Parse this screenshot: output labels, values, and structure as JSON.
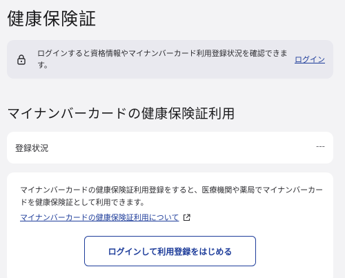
{
  "page": {
    "title": "健康保険証"
  },
  "login_banner": {
    "text": "ログインすると資格情報やマイナンバーカード利用登録状況を確認できます。",
    "link_label": "ログイン",
    "icon": "lock-icon"
  },
  "section": {
    "title": "マイナンバーカードの健康保険証利用"
  },
  "status": {
    "label": "登録状況",
    "value": "---"
  },
  "info": {
    "text": "マイナンバーカードの健康保険証利用登録をすると、医療機関や薬局でマイナンバーカードを健康保険証として利用できます。",
    "link_label": "マイナンバーカードの健康保険証利用について",
    "link_icon": "external-link-icon",
    "button_label": "ログインして利用登録をはじめる"
  },
  "colors": {
    "background": "#f3f3f5",
    "banner": "#e9e9ef",
    "card": "#ffffff",
    "accent": "#1d3c9a",
    "text": "#1a1a1c"
  }
}
